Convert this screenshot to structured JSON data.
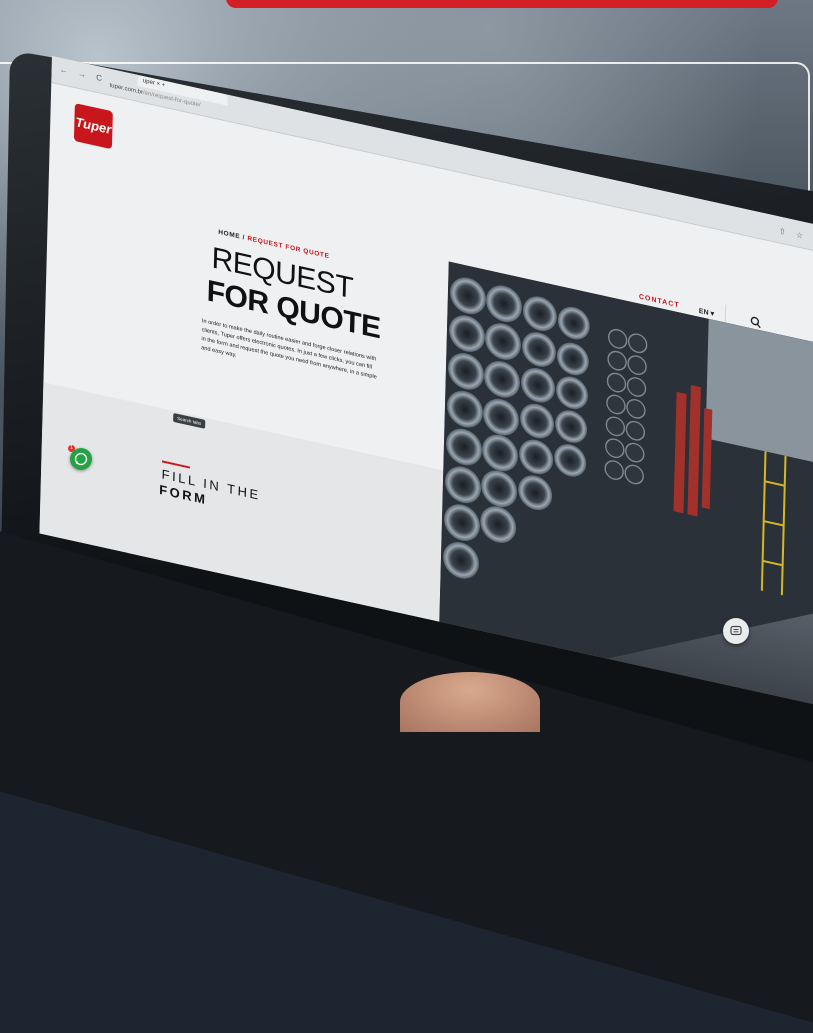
{
  "browser": {
    "nav_glyphs": "← → C",
    "tab_label": "uper ×  +",
    "url_domain": "tuper.com.br",
    "url_path": "/en/request-for-quote/",
    "actions_glyphs": "⇧ ☆ ⋮"
  },
  "site": {
    "logo_text": "Tuper",
    "nav": {
      "contact": "CONTACT",
      "language": "EN ▾",
      "search_icon": "search-icon"
    }
  },
  "page": {
    "breadcrumb_home": "HOME",
    "breadcrumb_sep": " / ",
    "breadcrumb_current": "REQUEST FOR QUOTE",
    "title_line1": "REQUEST",
    "title_line2": "FOR QUOTE",
    "intro": "In order to make the daily routine easier and forge closer relations with clients, Tuper offers electronic quotes. In just a few clicks, you can fill in the form and request the quote you need from anywhere, in a simple and easy way.",
    "search_tabs_label": "Search tabs",
    "form_heading_line1": "FILL IN THE",
    "form_heading_line2": "FORM"
  },
  "widgets": {
    "whatsapp_icon": "whatsapp-icon",
    "whatsapp_badge": "1",
    "chat_icon": "chat-icon"
  },
  "colors": {
    "brand_red": "#c8161d",
    "whatsapp_green": "#25a244",
    "page_bg": "#eef0f1"
  }
}
